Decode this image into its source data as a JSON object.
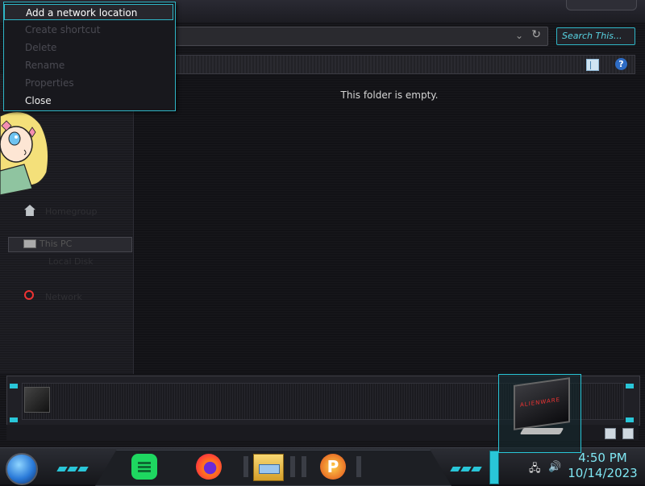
{
  "search": {
    "placeholder": "Search This..."
  },
  "content": {
    "empty_message": "This folder is empty."
  },
  "context_menu": {
    "items": [
      {
        "label": "Add a network location",
        "state": "highlighted"
      },
      {
        "label": "Create shortcut",
        "state": "disabled"
      },
      {
        "label": "Delete",
        "state": "disabled"
      },
      {
        "label": "Rename",
        "state": "disabled"
      },
      {
        "label": "Properties",
        "state": "disabled"
      },
      {
        "label": "Close",
        "state": "enabled"
      }
    ]
  },
  "nav_pane": {
    "items": [
      {
        "label": "Homegroup",
        "icon": "homegroup-icon"
      },
      {
        "label": "This PC",
        "icon": "computer-icon"
      },
      {
        "label": "Local Disk",
        "icon": "drive-icon"
      },
      {
        "label": "Network",
        "icon": "network-icon"
      }
    ]
  },
  "taskbar": {
    "apps": [
      {
        "name": "Spotify",
        "icon": "spotify-icon"
      },
      {
        "name": "Firefox",
        "icon": "firefox-icon"
      },
      {
        "name": "File Explorer",
        "icon": "folder-icon"
      },
      {
        "name": "P app",
        "icon": "p-app-icon",
        "glyph": "P"
      }
    ],
    "clock": {
      "time": "4:50 PM",
      "date": "10/14/2023"
    }
  },
  "preview": {
    "brand": "ALIENWARE"
  },
  "colors": {
    "accent": "#29c6d8",
    "clock": "#7fe6f2"
  }
}
